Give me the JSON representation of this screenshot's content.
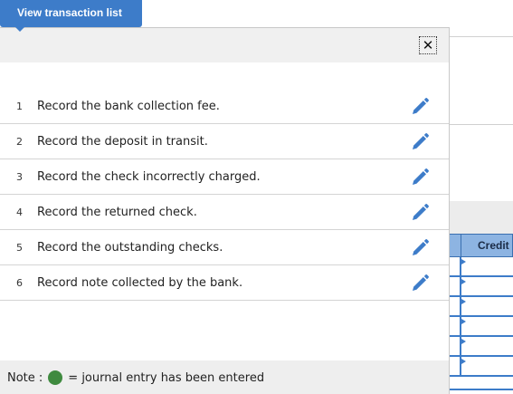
{
  "tab": {
    "label": "View transaction list"
  },
  "popup": {
    "close_glyph": "✕",
    "items": [
      {
        "number": "1",
        "label": "Record the bank collection fee."
      },
      {
        "number": "2",
        "label": "Record the deposit in transit."
      },
      {
        "number": "3",
        "label": "Record the check incorrectly charged."
      },
      {
        "number": "4",
        "label": "Record the returned check."
      },
      {
        "number": "5",
        "label": "Record the outstanding checks."
      },
      {
        "number": "6",
        "label": "Record note collected by the bank."
      }
    ],
    "note": {
      "prefix": "Note :",
      "suffix": "= journal entry has been entered"
    }
  },
  "background": {
    "credit_header": "Credit"
  },
  "colors": {
    "accent": "#3d7cc9",
    "entered": "#3f8a3f",
    "header_bg": "#8db4e2"
  }
}
